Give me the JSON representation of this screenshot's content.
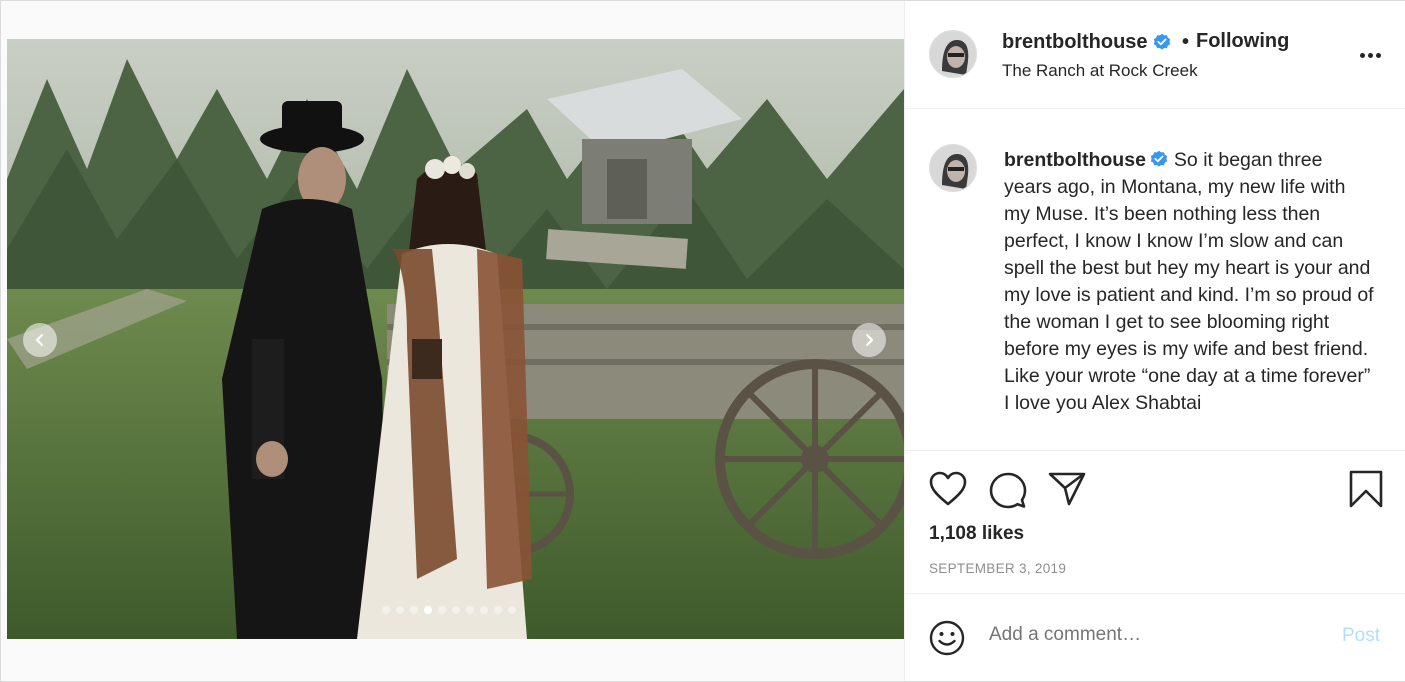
{
  "post": {
    "username": "brentbolthouse",
    "follow_separator": "•",
    "follow_status": "Following",
    "location": "The Ranch at Rock Creek",
    "caption": "So it began three years ago, in Montana, my new life with my Muse. It’s been nothing less then perfect, I know I know I’m slow and can spell the best but hey my heart is your and my love is patient and kind. I’m so proud of the woman I get to see blooming right before my eyes is my wife and best friend. Like your wrote “one day at a time forever” I love you Alex Shabtai",
    "likes": "1,108 likes",
    "date": "SEPTEMBER 3, 2019"
  },
  "comment": {
    "placeholder": "Add a comment…",
    "post_label": "Post"
  },
  "carousel": {
    "total": 10,
    "active_index": 3
  },
  "colors": {
    "verified": "#3897f0",
    "text": "#262626",
    "muted": "#8e8e8e",
    "post_disabled": "#b2dffc"
  },
  "icons": [
    "verified-badge-icon",
    "more-options-icon",
    "heart-icon",
    "comment-icon",
    "share-icon",
    "bookmark-icon",
    "emoji-icon",
    "chevron-left-icon",
    "chevron-right-icon"
  ]
}
